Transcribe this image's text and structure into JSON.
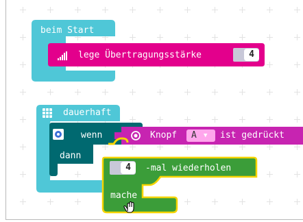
{
  "blocks": {
    "on_start": {
      "label": "beim Start"
    },
    "set_power": {
      "label": "lege Übertragungsstärke",
      "value": "4"
    },
    "forever": {
      "label": "dauerhaft"
    },
    "if_block": {
      "if_label": "wenn",
      "then_label": "dann"
    },
    "button_pressed": {
      "prefix": "Knopf",
      "button": "A",
      "suffix": "ist gedrückt"
    },
    "repeat": {
      "value": "4",
      "label": "-mal wiederholen",
      "do_label": "mache"
    }
  },
  "colors": {
    "basic": "#1fa1b8",
    "basic_light": "#4fc7d7",
    "radio": "#e3008c",
    "logic": "#006970",
    "input": "#c724b1",
    "loops": "#3b9d39",
    "highlight": "#f5d400"
  }
}
